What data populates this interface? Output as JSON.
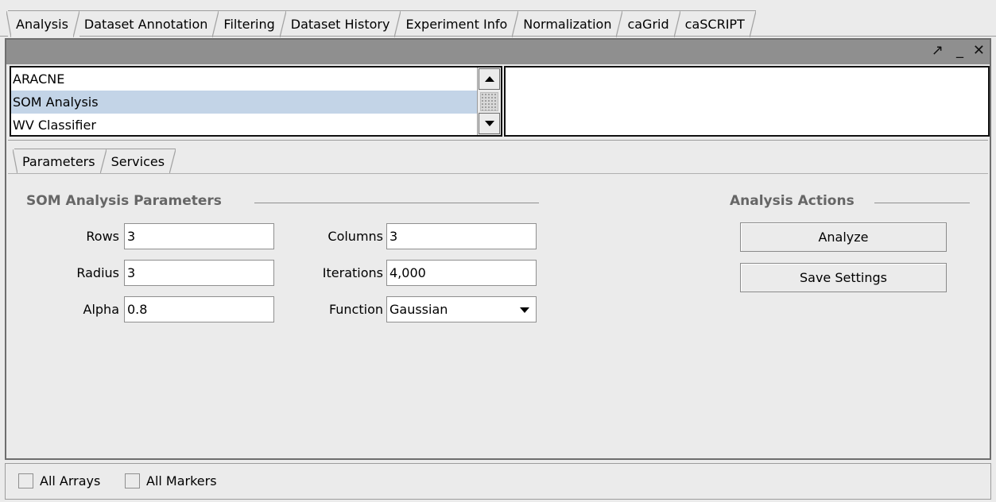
{
  "top_tabs": [
    "Analysis",
    "Dataset Annotation",
    "Filtering",
    "Dataset History",
    "Experiment Info",
    "Normalization",
    "caGrid",
    "caSCRIPT"
  ],
  "window_controls": {
    "maximize": "↗",
    "minimize": "_",
    "close": "✕"
  },
  "algorithms": [
    "ARACNE",
    "SOM Analysis",
    "WV Classifier"
  ],
  "selected_algorithm": "SOM Analysis",
  "sub_tabs": [
    "Parameters",
    "Services"
  ],
  "params": {
    "section_title": "SOM Analysis Parameters",
    "rows_label": "Rows",
    "rows_value": "3",
    "radius_label": "Radius",
    "radius_value": "3",
    "alpha_label": "Alpha",
    "alpha_value": "0.8",
    "columns_label": "Columns",
    "columns_value": "3",
    "iterations_label": "Iterations",
    "iterations_value": "4,000",
    "function_label": "Function",
    "function_value": "Gaussian"
  },
  "actions": {
    "section_title": "Analysis Actions",
    "analyze": "Analyze",
    "save_settings": "Save Settings"
  },
  "bottom": {
    "all_arrays": "All Arrays",
    "all_markers": "All Markers"
  },
  "colors": {
    "titlebar": "#8f8f8f",
    "selection": "#c3d4e7",
    "background": "#ebebeb"
  }
}
